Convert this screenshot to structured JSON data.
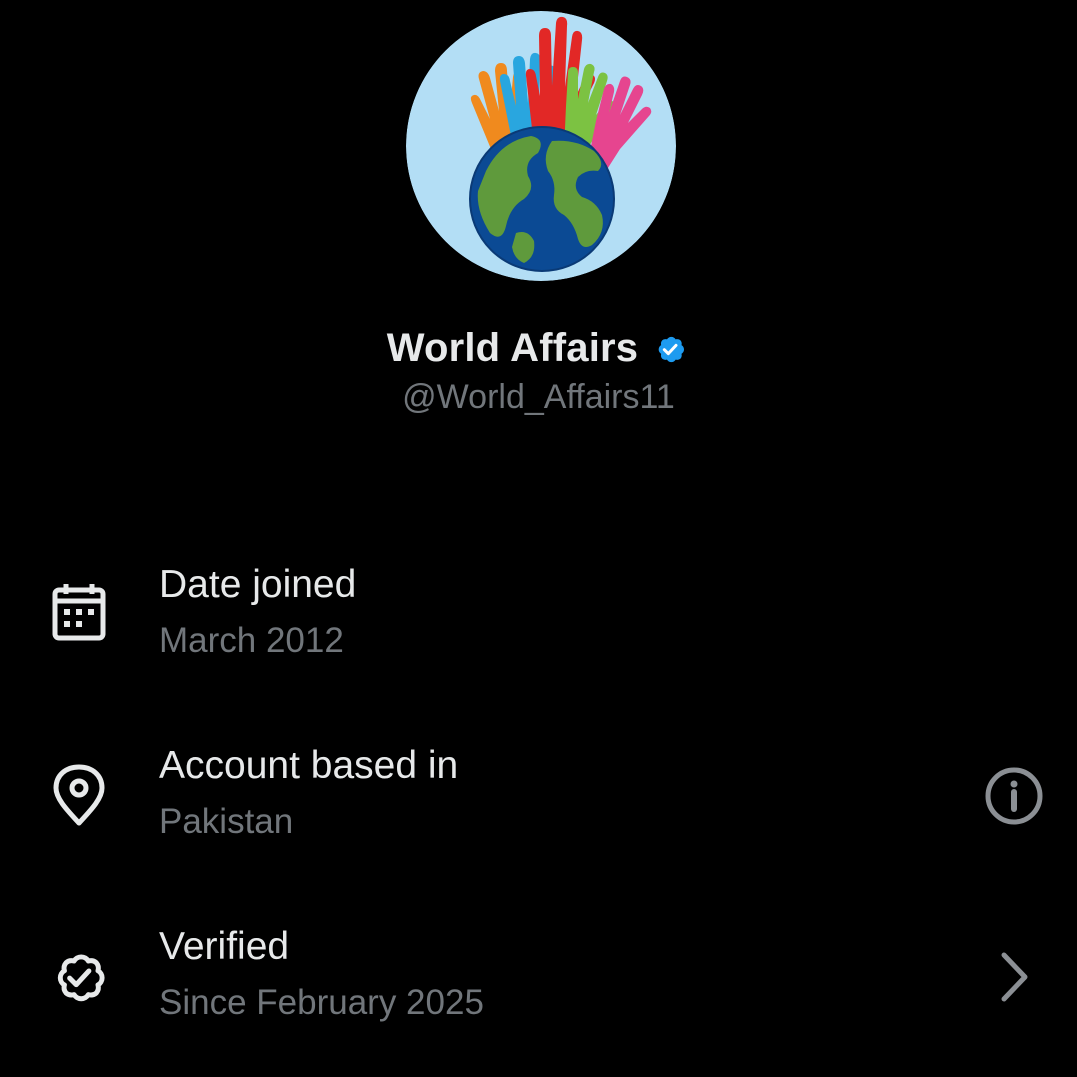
{
  "profile": {
    "display_name": "World Affairs",
    "handle": "@World_Affairs11",
    "avatar_icon": "hands-over-globe-logo",
    "verified_badge_icon": "verified-badge-icon",
    "verified_badge_color": "#1d9bf0"
  },
  "about": {
    "rows": [
      {
        "icon": "calendar-icon",
        "title": "Date joined",
        "value": "March 2012"
      },
      {
        "icon": "location-pin-icon",
        "title": "Account based in",
        "value": "Pakistan",
        "action_icon": "info-icon"
      },
      {
        "icon": "verified-outline-icon",
        "title": "Verified",
        "value": "Since February 2025",
        "action_icon": "chevron-right-icon"
      }
    ]
  },
  "colors": {
    "background": "#000000",
    "primary_text": "#e7e9ea",
    "secondary_text": "#71767b",
    "accent": "#1d9bf0"
  }
}
